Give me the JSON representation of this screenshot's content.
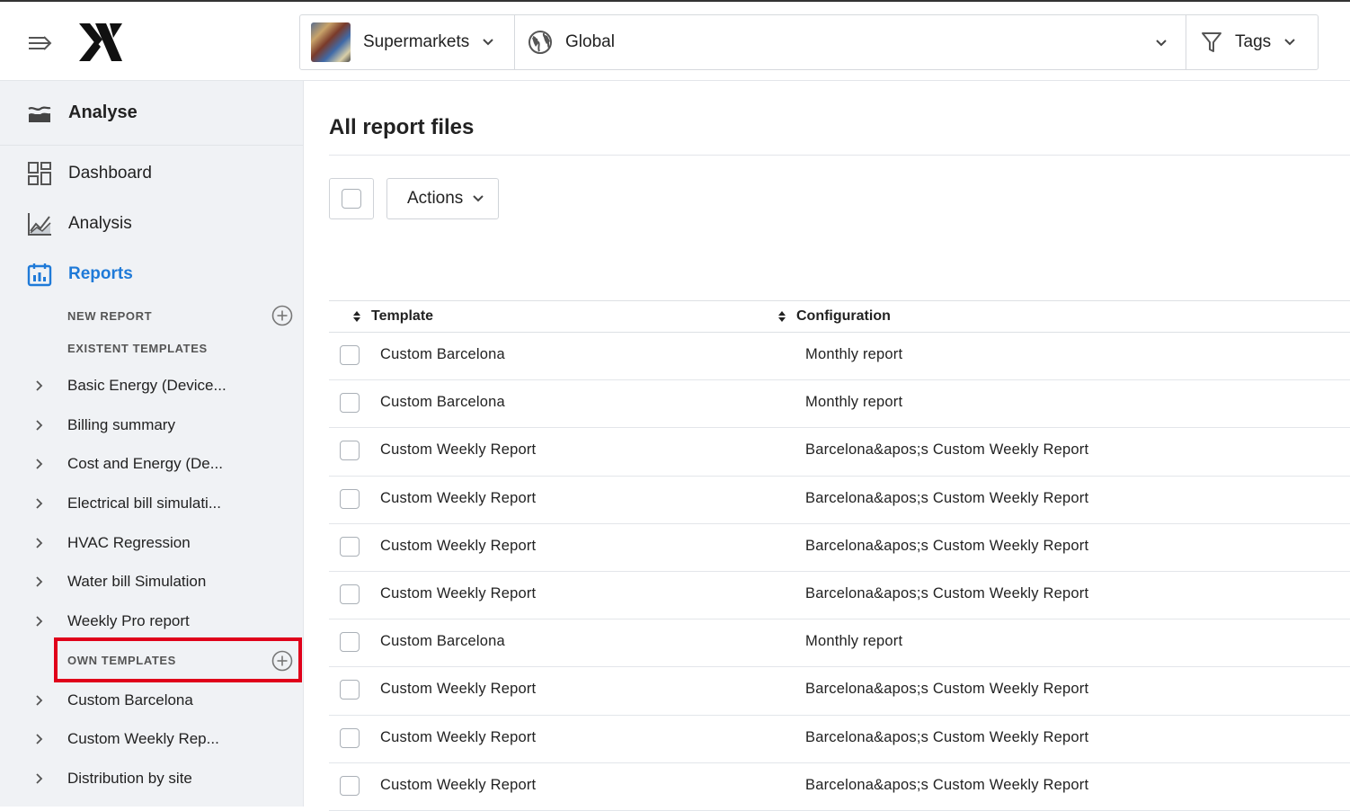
{
  "topbar": {
    "site_selector": {
      "label": "Supermarkets"
    },
    "scope_selector": {
      "label": "Global"
    },
    "tags_selector": {
      "label": "Tags"
    }
  },
  "sidebar": {
    "section_title": "Analyse",
    "nav": [
      {
        "label": "Dashboard",
        "icon": "dashboard-icon"
      },
      {
        "label": "Analysis",
        "icon": "analysis-chart-icon"
      },
      {
        "label": "Reports",
        "icon": "reports-calendar-icon",
        "active": true
      }
    ],
    "new_report_heading": "NEW REPORT",
    "existent_templates_heading": "EXISTENT TEMPLATES",
    "existent_templates": [
      {
        "label": "Basic Energy (Device..."
      },
      {
        "label": "Billing summary"
      },
      {
        "label": "Cost and Energy (De..."
      },
      {
        "label": "Electrical bill simulati..."
      },
      {
        "label": "HVAC Regression"
      },
      {
        "label": "Water bill Simulation"
      },
      {
        "label": "Weekly Pro report"
      }
    ],
    "own_templates_heading": "OWN TEMPLATES",
    "own_templates": [
      {
        "label": "Custom Barcelona"
      },
      {
        "label": "Custom Weekly Rep..."
      },
      {
        "label": "Distribution by site"
      }
    ]
  },
  "main": {
    "title": "All report files",
    "actions_label": "Actions",
    "table": {
      "columns": [
        "Template",
        "Configuration"
      ],
      "rows": [
        {
          "template": "Custom Barcelona",
          "configuration": "Monthly report"
        },
        {
          "template": "Custom Barcelona",
          "configuration": "Monthly report"
        },
        {
          "template": "Custom Weekly Report",
          "configuration": "Barcelona&apos;s Custom Weekly Report"
        },
        {
          "template": "Custom Weekly Report",
          "configuration": "Barcelona&apos;s Custom Weekly Report"
        },
        {
          "template": "Custom Weekly Report",
          "configuration": "Barcelona&apos;s Custom Weekly Report"
        },
        {
          "template": "Custom Weekly Report",
          "configuration": "Barcelona&apos;s Custom Weekly Report"
        },
        {
          "template": "Custom Barcelona",
          "configuration": "Monthly report"
        },
        {
          "template": "Custom Weekly Report",
          "configuration": "Barcelona&apos;s Custom Weekly Report"
        },
        {
          "template": "Custom Weekly Report",
          "configuration": "Barcelona&apos;s Custom Weekly Report"
        },
        {
          "template": "Custom Weekly Report",
          "configuration": "Barcelona&apos;s Custom Weekly Report"
        }
      ]
    }
  },
  "colors": {
    "accent": "#1f7ad8",
    "highlight": "#e0001a",
    "sidebar_bg": "#f0f2f5"
  }
}
